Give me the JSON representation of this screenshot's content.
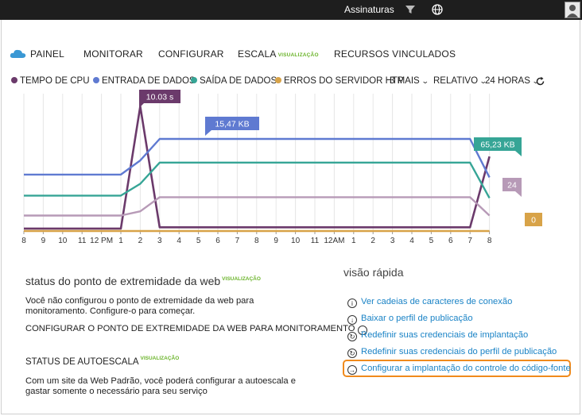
{
  "topbar": {
    "subscriptions_label": "Assinaturas"
  },
  "nav": {
    "tabs": [
      {
        "label": "PAINEL"
      },
      {
        "label": "MONITORAR"
      },
      {
        "label": "CONFIGURAR"
      },
      {
        "label": "ESCALA",
        "badge": "VISUALIZAÇÃO"
      },
      {
        "label": "RECURSOS VINCULADOS"
      }
    ]
  },
  "legend": {
    "items": [
      {
        "label": "TEMPO DE CPU",
        "color": "#6b3a6b"
      },
      {
        "label": "ENTRADA DE DADOS",
        "color": "#5f7ad1"
      },
      {
        "label": "SAÍDA DE DADOS",
        "color": "#36a596"
      },
      {
        "label": "ERROS DO SERVIDOR HTP",
        "color": "#d8a348"
      }
    ],
    "more": "3 MAIS",
    "scale": "RELATIVO",
    "range": "24 HORAS"
  },
  "chart_data": {
    "type": "line",
    "x": [
      "8",
      "9",
      "10",
      "11",
      "12 PM",
      "1",
      "2",
      "3",
      "4",
      "5",
      "6",
      "7",
      "8",
      "9",
      "10",
      "11",
      "12AM",
      "1",
      "2",
      "3",
      "4",
      "5",
      "6",
      "7",
      "8"
    ],
    "series": [
      {
        "color": "#6b3a6b",
        "values": [
          0.2,
          0.2,
          0.2,
          0.2,
          0.2,
          0.2,
          10.03,
          0.3,
          0.3,
          0.3,
          0.3,
          0.3,
          0.3,
          0.3,
          0.3,
          0.3,
          0.3,
          0.3,
          0.3,
          0.3,
          0.3,
          0.3,
          0.3,
          0.3,
          6
        ]
      },
      {
        "color": "#5f7ad1",
        "values": [
          40,
          40,
          40,
          40,
          40,
          40,
          50,
          65.23,
          65.23,
          65.23,
          65.23,
          65.23,
          65.23,
          65.23,
          65.23,
          65.23,
          65.23,
          65.23,
          65.23,
          65.23,
          65.23,
          65.23,
          65.23,
          65.23,
          38
        ]
      },
      {
        "color": "#36a596",
        "values": [
          30,
          30,
          30,
          30,
          30,
          30,
          40,
          58,
          58,
          58,
          58,
          58,
          58,
          58,
          58,
          58,
          58,
          58,
          58,
          58,
          58,
          58,
          58,
          58,
          28
        ]
      },
      {
        "color": "#b79ab7",
        "values": [
          11,
          11,
          11,
          11,
          11,
          11,
          14,
          24,
          24,
          24,
          24,
          24,
          24,
          24,
          24,
          24,
          24,
          24,
          24,
          24,
          24,
          24,
          24,
          24,
          11
        ]
      },
      {
        "color": "#d8a348",
        "values": [
          0,
          0,
          0,
          0,
          0,
          0,
          0,
          0,
          0,
          0,
          0,
          0,
          0,
          0,
          0,
          0,
          0,
          0,
          0,
          0,
          0,
          0,
          0,
          0,
          0
        ]
      }
    ],
    "labels": [
      {
        "text": "10.03 s",
        "color": "#6b3a6b"
      },
      {
        "text": "15,47 KB",
        "color": "#5f7ad1"
      },
      {
        "text": "65,23 KB",
        "color": "#36a596"
      },
      {
        "text": "24",
        "color": "#b79ab7"
      },
      {
        "text": "0",
        "color": "#d8a348"
      }
    ]
  },
  "endpoint": {
    "title": "status do ponto de extremidade da web",
    "badge": "VISUALIZAÇÃO",
    "text": "Você não configurou o ponto de extremidade da web para monitoramento. Configure-o para começar.",
    "action": "CONFIGURAR O PONTO DE EXTREMIDADE DA WEB PARA MONITORAMENTO"
  },
  "autoscale": {
    "title": "STATUS DE AUTOESCALA",
    "badge": "VISUALIZAÇÃO",
    "text": "Com um site da Web Padrão, você poderá configurar a autoescala e gastar somente o necessário para seu serviço"
  },
  "quick": {
    "title": "visão rápida",
    "items": [
      {
        "label": "Ver cadeias de caracteres de conexão",
        "icon": "i"
      },
      {
        "label": "Baixar o perfil de publicação",
        "icon": "↓"
      },
      {
        "label": "Redefinir suas credenciais de implantação",
        "icon": "↻"
      },
      {
        "label": "Redefinir suas credenciais do perfil de publicação",
        "icon": "↻"
      },
      {
        "label": "Configurar a implantação do controle do código-fonte",
        "icon": "→"
      }
    ]
  }
}
